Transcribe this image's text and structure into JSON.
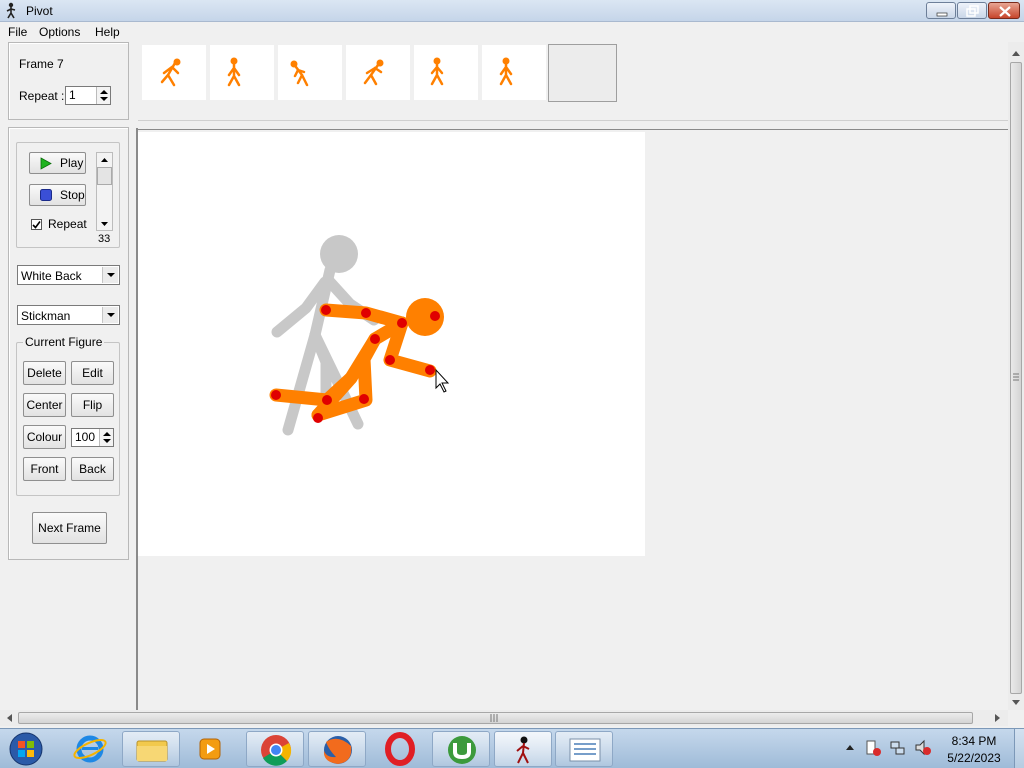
{
  "window": {
    "title": "Pivot"
  },
  "menu": [
    "File",
    "Options",
    "Help"
  ],
  "frame_panel": {
    "frame_label": "Frame 7",
    "repeat_label": "Repeat :",
    "repeat_value": "1"
  },
  "playback": {
    "play_label": "Play",
    "stop_label": "Stop",
    "repeat_label": "Repeat",
    "repeat_checked": true,
    "speed_value": "33"
  },
  "background_select": {
    "value": "White Back"
  },
  "figure_type_select": {
    "value": "Stickman"
  },
  "current_figure": {
    "title": "Current Figure",
    "delete_label": "Delete",
    "edit_label": "Edit",
    "center_label": "Center",
    "flip_label": "Flip",
    "colour_label": "Colour",
    "colour_value": "100",
    "front_label": "Front",
    "back_label": "Back"
  },
  "next_frame_label": "Next Frame",
  "frames_strip": {
    "frame_count": 6,
    "selected_empty_slot": true
  },
  "colors": {
    "figure": "#ff8000",
    "joints": "#e00000",
    "ghost": "#c8c8c8",
    "canvas": "#ffffff"
  },
  "taskbar": {
    "icons": [
      "start-orb-icon",
      "internet-explorer-icon",
      "file-explorer-icon",
      "media-player-icon",
      "chrome-icon",
      "firefox-icon",
      "opera-icon",
      "utorrent-icon",
      "pivot-icon",
      "list-app-icon"
    ],
    "time": "8:34 PM",
    "date": "5/22/2023"
  }
}
